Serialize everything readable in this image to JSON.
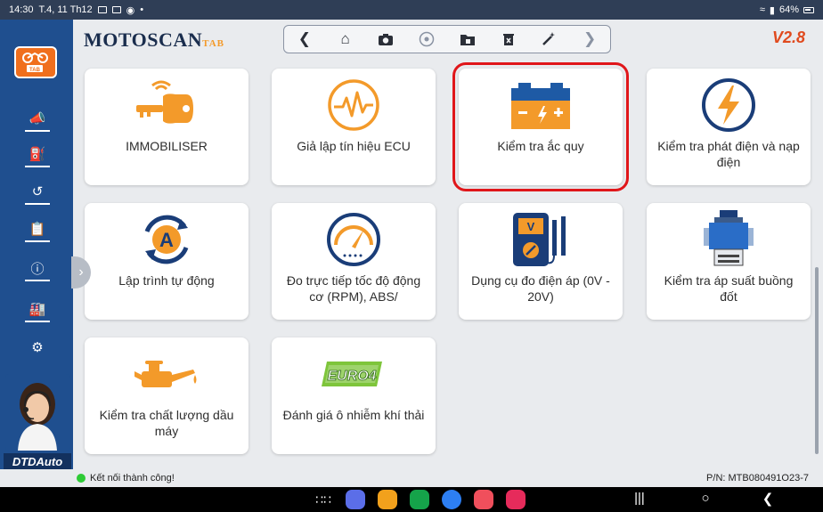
{
  "statusbar": {
    "time": "14:30",
    "date": "T.4, 11 Th12",
    "battery": "64%"
  },
  "app": {
    "title": "MOTOSCAN",
    "title_suffix": "TAB",
    "version": "V2.8",
    "logo_text": "TAB"
  },
  "toolbar": {
    "icons": [
      "chevron-left-icon",
      "home-icon",
      "camera-icon",
      "record-icon",
      "folder-icon",
      "trash-icon",
      "magic-wand-icon",
      "chevron-right-icon"
    ]
  },
  "sidebar": {
    "items": [
      "megaphone-icon",
      "fuel-pump-icon",
      "history-icon",
      "clipboard-icon",
      "info-icon",
      "factory-icon",
      "gear-icon"
    ],
    "brand": "DTDAuto"
  },
  "cards": [
    {
      "label": "IMMOBILISER",
      "icon": "key-icon"
    },
    {
      "label": "Giả lập tín hiệu ECU",
      "icon": "signal-wave-icon"
    },
    {
      "label": "Kiểm tra ắc quy",
      "icon": "battery-icon",
      "selected": true
    },
    {
      "label": "Kiểm tra phát điện và nạp điện",
      "icon": "lightning-icon"
    },
    {
      "label": "Lập trình tự động",
      "icon": "auto-program-icon"
    },
    {
      "label": "Đo trực tiếp tốc độ động cơ (RPM), ABS/",
      "icon": "speedometer-icon"
    },
    {
      "label": "Dụng cụ đo điện áp (0V - 20V)",
      "icon": "voltmeter-icon"
    },
    {
      "label": "Kiểm tra áp suất buồng đốt",
      "icon": "compression-gauge-icon"
    },
    {
      "label": "Kiểm tra chất lượng dầu máy",
      "icon": "oil-can-icon"
    },
    {
      "label": "Đánh giá ô nhiễm khí thải",
      "icon": "euro4-icon",
      "icon_text": "EURO4"
    }
  ],
  "status": {
    "message": "Kết nối thành công!",
    "part_number": "P/N: MTB080491O23-7"
  },
  "colors": {
    "sidebar": "#1f4f8f",
    "accent_orange": "#f39a2a",
    "selection": "#e0161a"
  }
}
